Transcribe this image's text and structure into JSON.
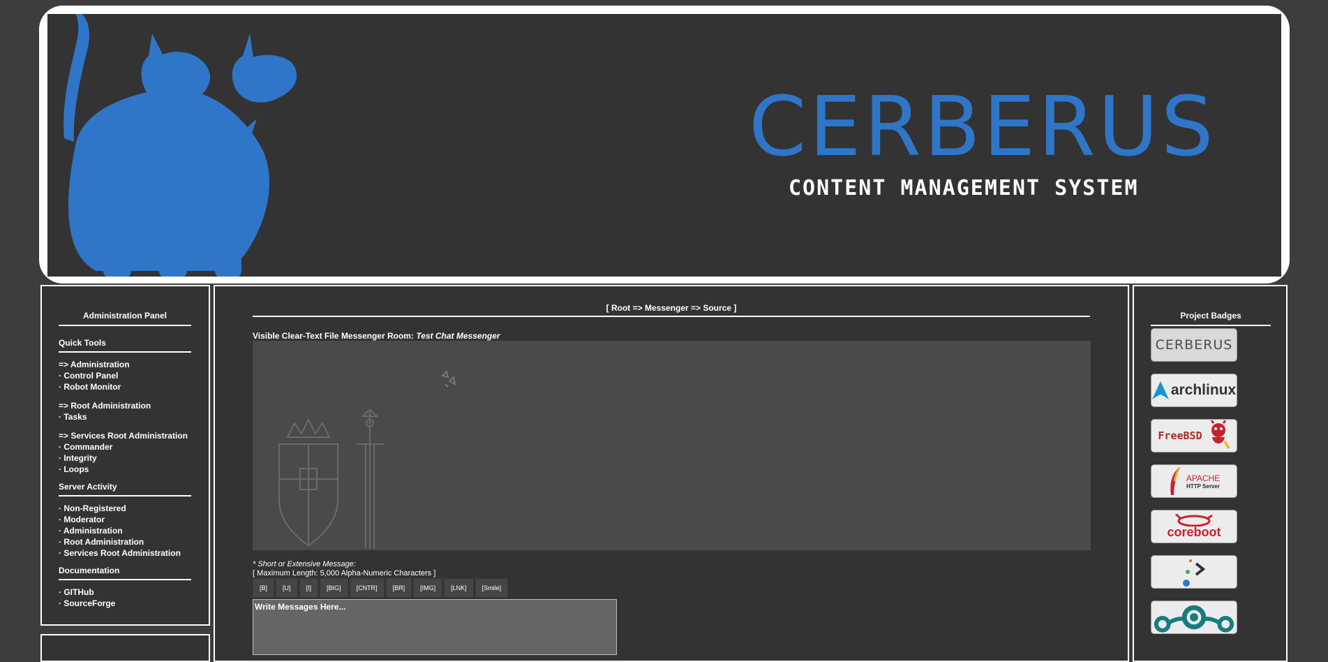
{
  "banner": {
    "title": "CERBERUS",
    "subtitle": "CONTENT MANAGEMENT SYSTEM",
    "mascot": "three-headed-dog-logo",
    "brand_color": "#2f76c8"
  },
  "left_panel": {
    "title": "Administration Panel",
    "quick_tools": {
      "heading": "Quick Tools",
      "groups": [
        [
          "=> Administration",
          "· Control Panel",
          "· Robot Monitor"
        ],
        [
          "=> Root Administration",
          "· Tasks"
        ],
        [
          "=> Services Root Administration",
          "· Commander",
          "· Integrity",
          "· Loops"
        ]
      ]
    },
    "server_activity": {
      "heading": "Server Activity",
      "items": [
        "· Non-Registered",
        "· Moderator",
        "· Administration",
        "· Root Administration",
        "· Services Root Administration"
      ]
    },
    "documentation": {
      "heading": "Documentation",
      "items": [
        "· GITHub",
        "· SourceForge"
      ]
    }
  },
  "main": {
    "breadcrumb": "[ Root => Messenger => Source ]",
    "room_label": "Visible Clear-Text File Messenger Room:",
    "room_name": "Test Chat Messenger",
    "message_label": "* Short or Extensive Message:",
    "max_length": "[ Maximum Length: 5,000 Alpha-Numeric Characters ]",
    "toolbar": [
      "[B]",
      "[U]",
      "[I]",
      "[BIG]",
      "[CNTR]",
      "[BR]",
      "[IMG]",
      "[LNK]",
      "[Smile]"
    ],
    "input_placeholder": "Write Messages Here..."
  },
  "right_panel": {
    "title": "Project Badges",
    "badges": [
      {
        "name": "cerberus-badge",
        "text": "CERBERUS"
      },
      {
        "name": "archlinux-badge",
        "text": "archlinux"
      },
      {
        "name": "freebsd-badge",
        "text": "FreeBSD"
      },
      {
        "name": "apache-badge",
        "text": "APACHE",
        "text2": "HTTP Server"
      },
      {
        "name": "coreboot-badge",
        "text": "coreboot"
      },
      {
        "name": "terminal-badge",
        "text": ""
      },
      {
        "name": "lineage-badge",
        "text": ""
      }
    ]
  }
}
